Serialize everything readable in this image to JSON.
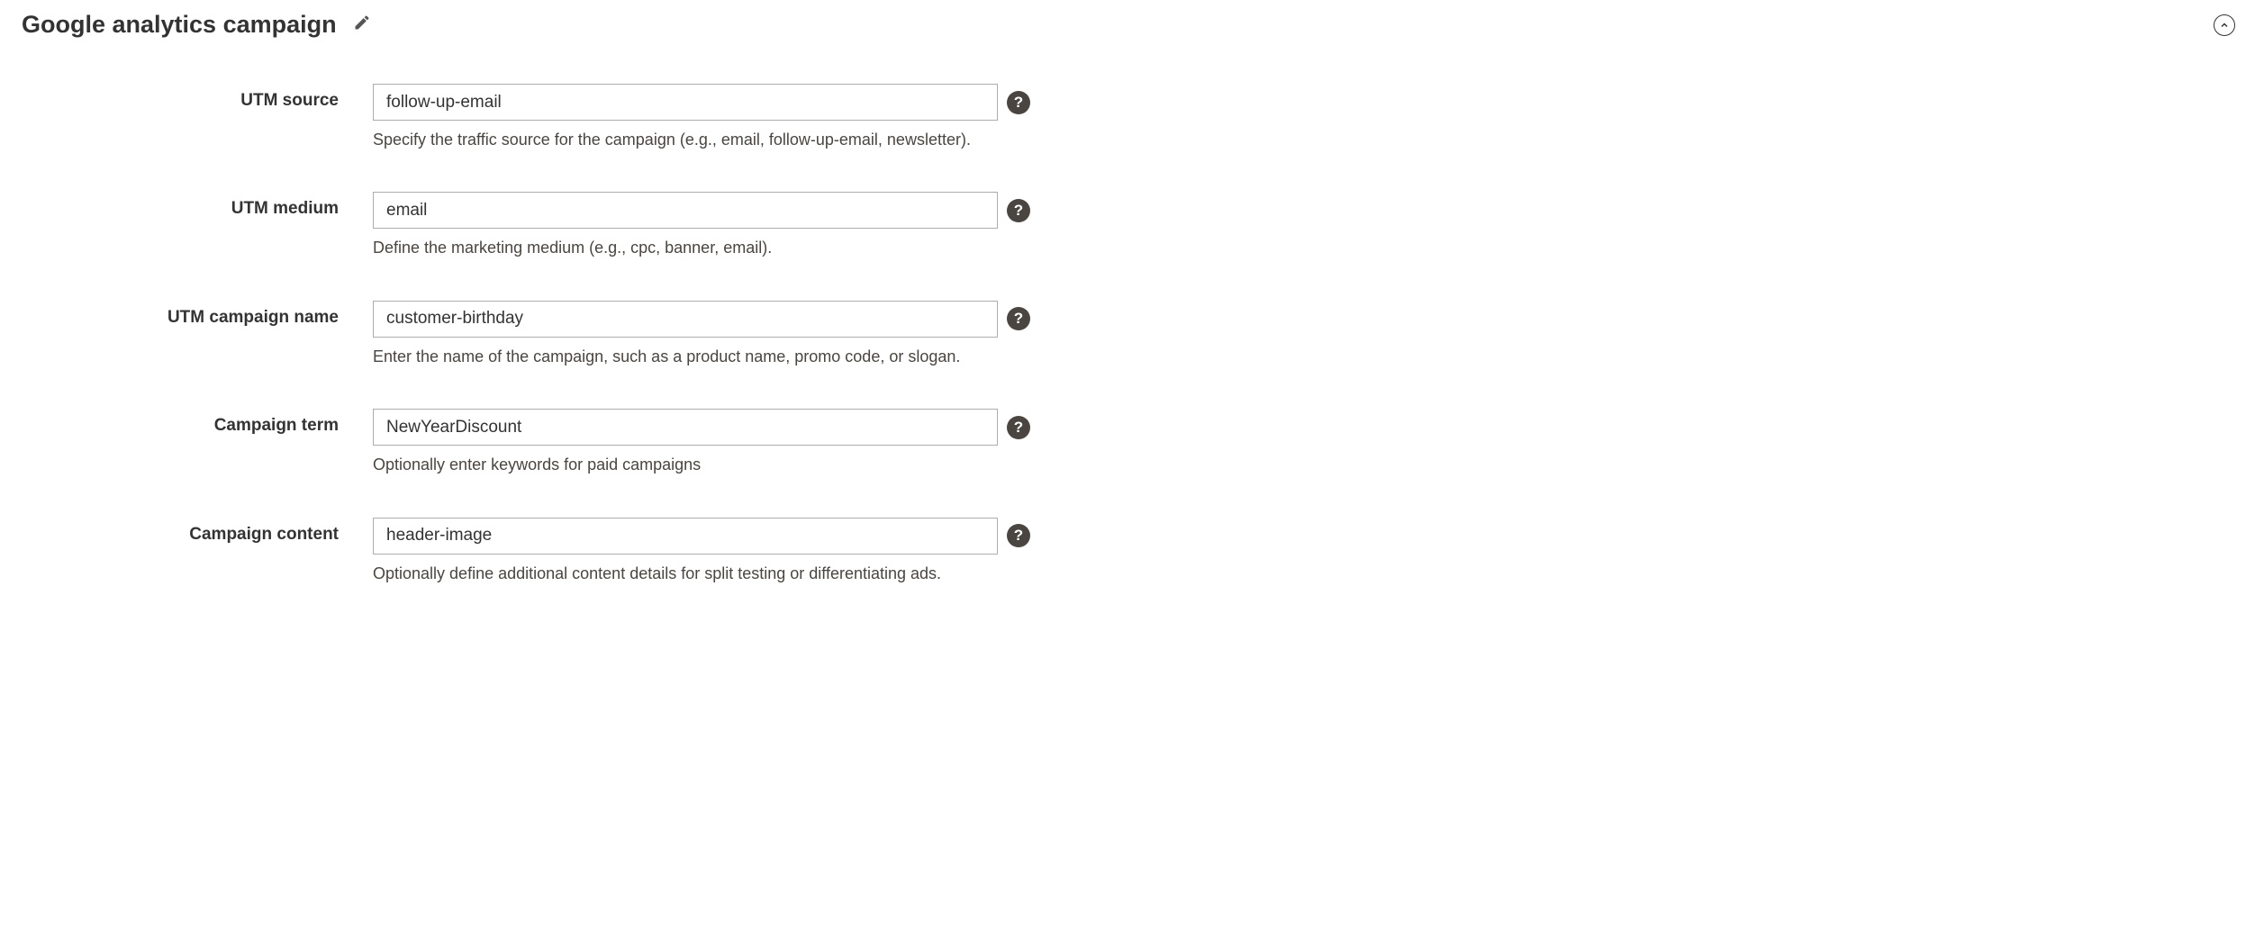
{
  "section": {
    "title": "Google analytics campaign"
  },
  "fields": {
    "utm_source": {
      "label": "UTM source",
      "value": "follow-up-email",
      "hint": "Specify the traffic source for the campaign (e.g., email, follow-up-email, newsletter)."
    },
    "utm_medium": {
      "label": "UTM medium",
      "value": "email",
      "hint": "Define the marketing medium (e.g., cpc, banner, email)."
    },
    "utm_campaign": {
      "label": "UTM campaign name",
      "value": "customer-birthday",
      "hint": "Enter the name of the campaign, such as a product name, promo code, or slogan."
    },
    "campaign_term": {
      "label": "Campaign term",
      "value": "NewYearDiscount",
      "hint": "Optionally enter keywords for paid campaigns"
    },
    "campaign_content": {
      "label": "Campaign content",
      "value": "header-image",
      "hint": "Optionally define additional content details for split testing or differentiating ads."
    }
  },
  "help_glyph": "?"
}
